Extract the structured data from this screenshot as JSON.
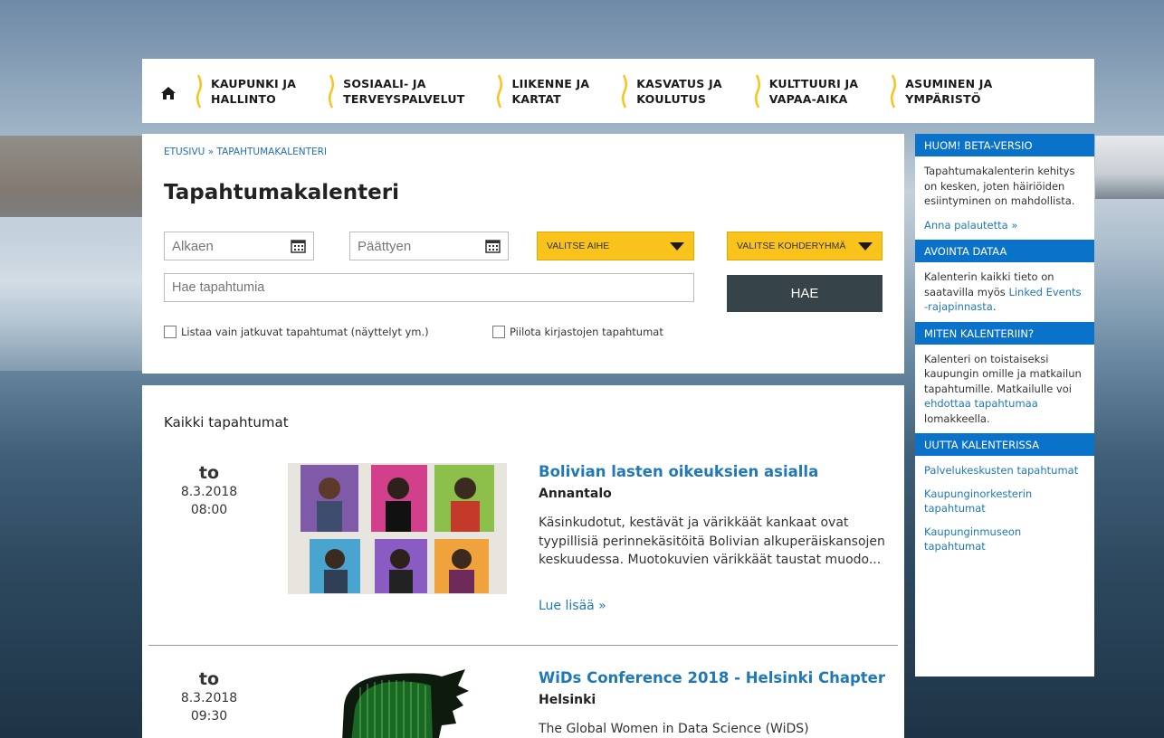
{
  "nav": {
    "items": [
      {
        "line1": "KAUPUNKI JA",
        "line2": "HALLINTO"
      },
      {
        "line1": "SOSIAALI- JA",
        "line2": "TERVEYSPALVELUT"
      },
      {
        "line1": "LIIKENNE JA",
        "line2": "KARTAT"
      },
      {
        "line1": "KASVATUS JA",
        "line2": "KOULUTUS"
      },
      {
        "line1": "KULTTUURI JA",
        "line2": "VAPAA-AIKA"
      },
      {
        "line1": "ASUMINEN JA",
        "line2": "YMPÄRISTÖ"
      }
    ]
  },
  "breadcrumb": {
    "home": "ETUSIVU",
    "sep": " » ",
    "current": "TAPAHTUMAKALENTERI"
  },
  "page_title": "Tapahtumakalenteri",
  "filters": {
    "start_placeholder": "Alkaen",
    "end_placeholder": "Päättyen",
    "topic_label": "VALITSE AIHE",
    "audience_label": "VALITSE KOHDERYHMÄ",
    "search_placeholder": "Hae tapahtumia",
    "search_button": "HAE",
    "check_ongoing": "Listaa vain jatkuvat tapahtumat (näyttelyt ym.)",
    "check_library": "Piilota kirjastojen tapahtumat"
  },
  "events_heading": "Kaikki tapahtumat",
  "events": [
    {
      "day": "to",
      "date": "8.3.2018",
      "time": "08:00",
      "title": "Bolivian lasten oikeuksien asialla",
      "place": "Annantalo",
      "desc": "Käsinkudotut, kestävät ja värikkäät kankaat ovat tyypillisiä perinnekäsitöitä Bolivian alkuperäiskansojen keskuudessa. Muotokuvien värikkäät taustat muodo...",
      "more": "Lue lisää »"
    },
    {
      "day": "to",
      "date": "8.3.2018",
      "time": "09:30",
      "title": "WiDs Conference 2018 - Helsinki Chapter",
      "place": "Helsinki",
      "desc": "The Global Women in Data Science (WiDS)"
    }
  ],
  "sidebar": {
    "beta_head": "HUOM! BETA-VERSIO",
    "beta_text": "Tapahtumakalenterin kehitys on kesken, joten häiriöiden esiintyminen on mahdollista.",
    "beta_link": "Anna palautetta »",
    "open_head": "AVOINTA DATAA",
    "open_text1": "Kalenterin kaikki tieto on saatavilla myös ",
    "open_link": "Linked Events -rajapinnasta",
    "open_text2": ".",
    "how_head": "MITEN KALENTERIIN?",
    "how_text1": "Kalenteri on toistaiseksi kaupungin omille ja matkailun tapahtumille. Matkailulle voi ",
    "how_link": "ehdottaa tapahtumaa",
    "how_text2": " lomakkeella.",
    "new_head": "UUTTA KALENTERISSA",
    "new_links": [
      "Palvelukeskusten tapahtumat",
      "Kaupunginorkesterin tapahtumat",
      "Kaupunginmuseon tapahtumat"
    ]
  },
  "colors": {
    "accent_blue": "#0a72c8",
    "link_blue": "#1f78b8",
    "select_yellow": "#f9c31b",
    "search_button": "#364348"
  }
}
